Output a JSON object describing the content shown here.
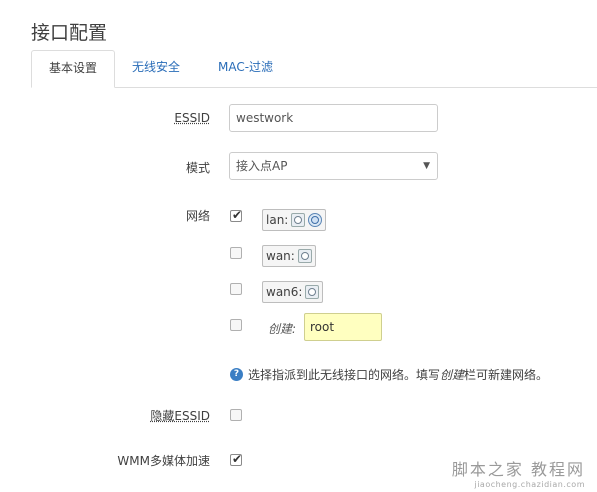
{
  "page": {
    "title": "接口配置"
  },
  "tabs": [
    {
      "label": "基本设置",
      "active": true
    },
    {
      "label": "无线安全",
      "active": false
    },
    {
      "label": "MAC-过滤",
      "active": false
    }
  ],
  "form": {
    "essid": {
      "label": "ESSID",
      "value": "westwork"
    },
    "mode": {
      "label": "模式",
      "value": "接入点AP"
    },
    "network": {
      "label": "网络",
      "items": [
        {
          "name": "lan:",
          "checked": true,
          "icons": [
            "ethernet-icon",
            "wifi-icon"
          ]
        },
        {
          "name": "wan:",
          "checked": false,
          "icons": [
            "ethernet-icon"
          ]
        },
        {
          "name": "wan6:",
          "checked": false,
          "icons": [
            "ethernet-icon"
          ]
        }
      ],
      "create": {
        "label": "创建:",
        "value": "root",
        "checked": false
      },
      "hint": {
        "before": "选择指派到此无线接口的网络。填写",
        "em": "创建",
        "after": "栏可新建网络。"
      }
    },
    "hide_essid": {
      "label": "隐藏ESSID",
      "checked": false
    },
    "wmm": {
      "label": "WMM多媒体加速",
      "checked": true
    }
  },
  "watermark": {
    "line1": "脚本之家 教程网",
    "line2": "jiaocheng.chazidian.com"
  }
}
